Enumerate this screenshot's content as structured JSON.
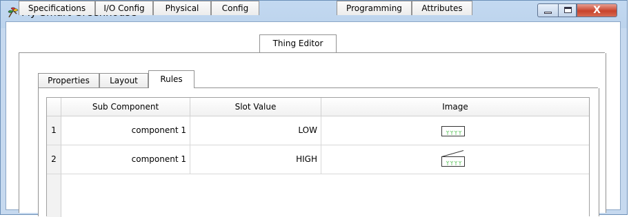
{
  "window": {
    "title": "My Smart Greenhouse",
    "app_icon": "greenhouse-plant-icon",
    "controls": {
      "minimize_icon": "minimize-icon",
      "maximize_icon": "maximize-icon",
      "close_label": "X"
    }
  },
  "main_tabs": [
    {
      "label": "Specifications",
      "active": false
    },
    {
      "label": "I/O Config",
      "active": false
    },
    {
      "label": "Physical",
      "active": false
    },
    {
      "label": "Config",
      "active": false
    },
    {
      "label": "Thing Editor",
      "active": true
    },
    {
      "label": "Programming",
      "active": false
    },
    {
      "label": "Attributes",
      "active": false
    }
  ],
  "sub_tabs": [
    {
      "label": "Properties",
      "active": false
    },
    {
      "label": "Layout",
      "active": false
    },
    {
      "label": "Rules",
      "active": true
    }
  ],
  "rules_table": {
    "columns": [
      "Sub Component",
      "Slot Value",
      "Image"
    ],
    "rows": [
      {
        "num": "1",
        "sub_component": "component 1",
        "slot_value": "LOW",
        "image": "greenhouse-closed-icon"
      },
      {
        "num": "2",
        "sub_component": "component 1",
        "slot_value": "HIGH",
        "image": "greenhouse-open-icon"
      }
    ]
  },
  "colors": {
    "title_bar": "#bcd3ec",
    "close_button": "#c8432c",
    "plant_green": "#7ccf7c"
  }
}
